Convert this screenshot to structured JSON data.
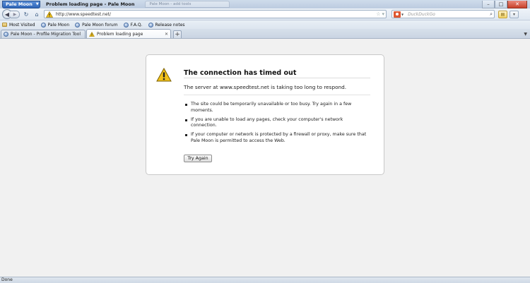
{
  "window": {
    "app_menu_label": "Pale Moon",
    "title": "Problem loading page - Pale Moon",
    "ghost_tab_label": "Pale Moon - add tools"
  },
  "navbar": {
    "url": "http://www.speedtest.net/",
    "search_placeholder": "DuckDuckGo"
  },
  "bookmarks": [
    {
      "label": "Most Visited",
      "icon": "folder-icon"
    },
    {
      "label": "Pale Moon",
      "icon": "globe-icon"
    },
    {
      "label": "Pale Moon forum",
      "icon": "globe-icon"
    },
    {
      "label": "F.A.Q.",
      "icon": "globe-icon"
    },
    {
      "label": "Release notes",
      "icon": "globe-icon"
    }
  ],
  "tabs": [
    {
      "label": "Pale Moon - Profile Migration Tool",
      "active": false
    },
    {
      "label": "Problem loading page",
      "active": true
    }
  ],
  "error": {
    "title": "The connection has timed out",
    "description": "The server at www.speedtest.net is taking too long to respond.",
    "items": [
      "The site could be temporarily unavailable or too busy. Try again in a few moments.",
      "If you are unable to load any pages, check your computer's network connection.",
      "If your computer or network is protected by a firewall or proxy, make sure that Pale Moon is permitted to access the Web."
    ],
    "button_label": "Try Again"
  },
  "status": {
    "text": "Done"
  },
  "colors": {
    "warning": "#f2c21b",
    "accent": "#2f66b8"
  }
}
